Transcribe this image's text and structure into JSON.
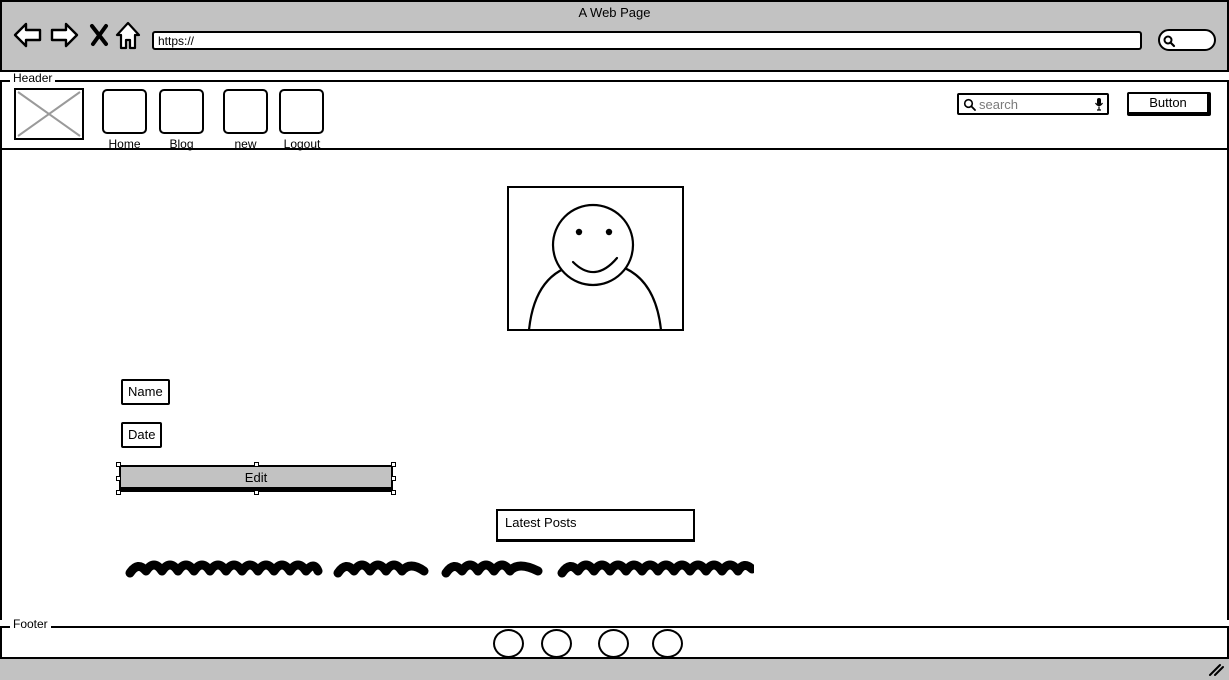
{
  "window": {
    "title": "A Web Page"
  },
  "browser": {
    "url": "https://",
    "nav_icons": [
      "back-icon",
      "forward-icon",
      "close-icon",
      "home-icon"
    ]
  },
  "header": {
    "group_label": "Header",
    "nav_items": [
      {
        "label": "Home"
      },
      {
        "label": "Blog"
      },
      {
        "label": "new"
      },
      {
        "label": "Logout"
      }
    ],
    "search": {
      "placeholder": "search"
    },
    "button_label": "Button"
  },
  "profile": {
    "name_label": "Name",
    "date_label": "Date",
    "edit_label": "Edit"
  },
  "posts": {
    "heading": "Latest Posts"
  },
  "footer": {
    "group_label": "Footer",
    "circle_count": 4
  },
  "colors": {
    "chrome_gray": "#c2c2c2",
    "stroke": "#000000",
    "placeholder_text": "#7a7a7a"
  }
}
